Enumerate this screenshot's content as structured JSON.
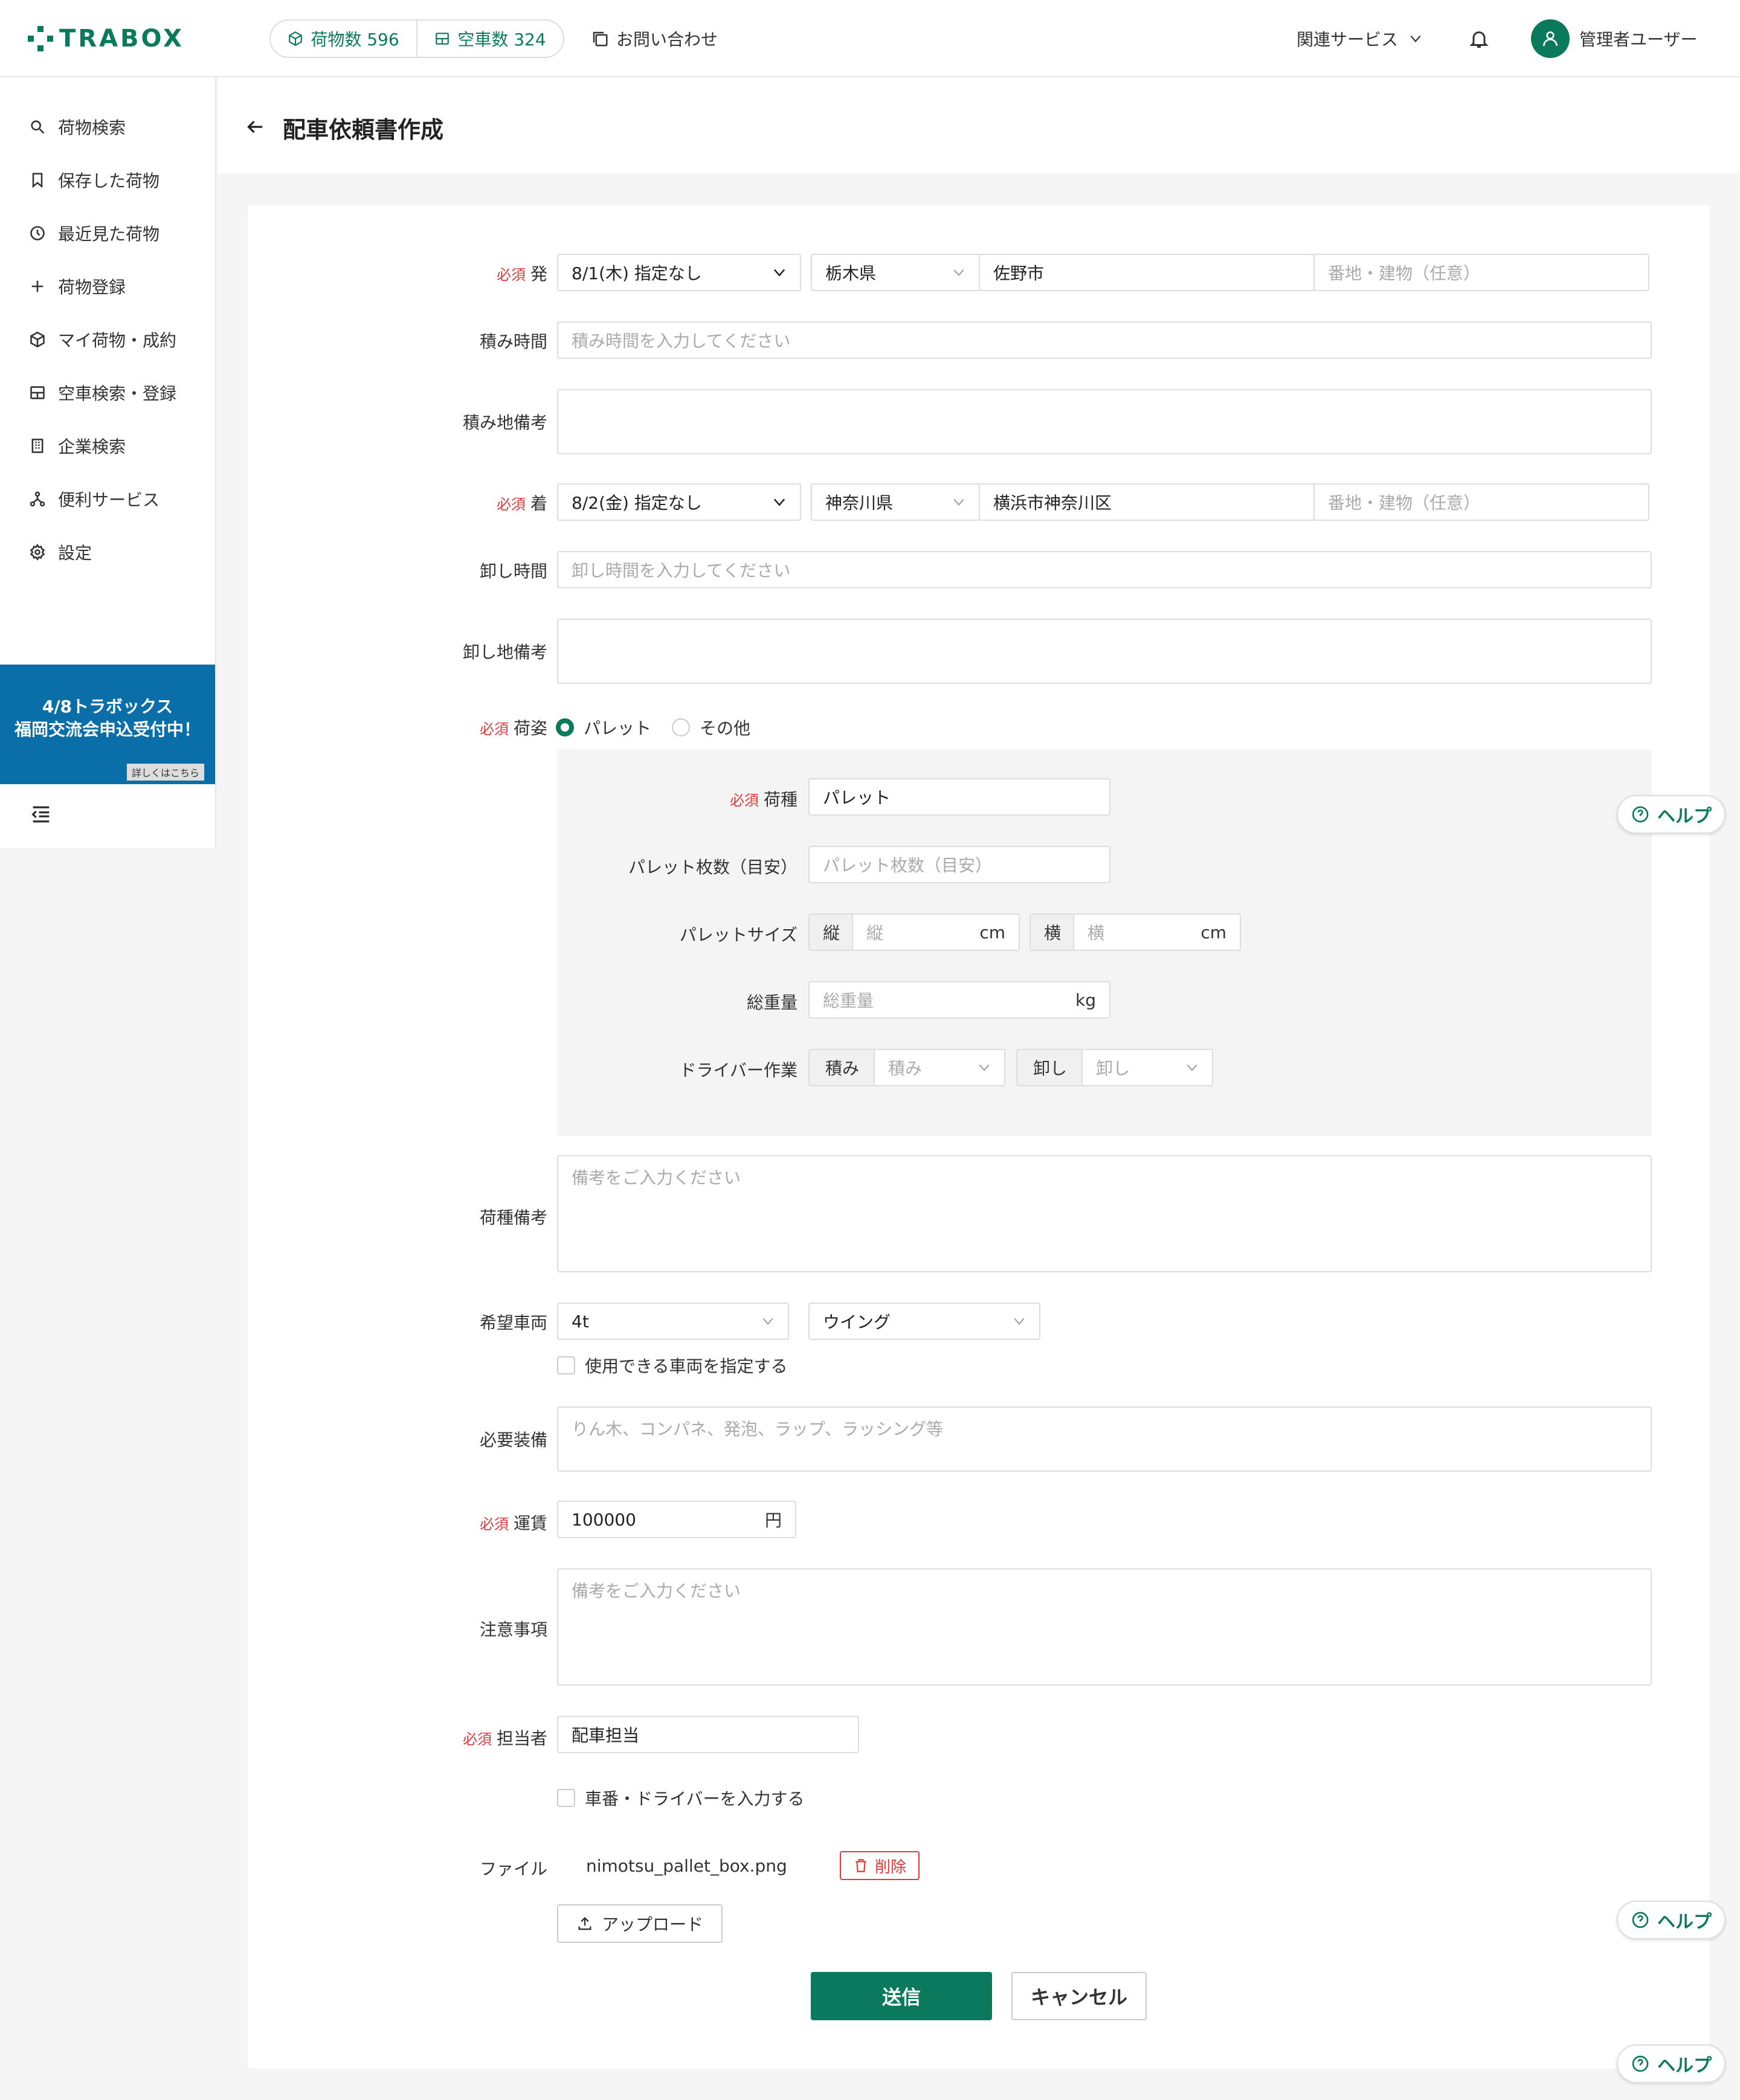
{
  "brand": {
    "name": "TRABOX",
    "color": "#0b7a5c"
  },
  "header": {
    "cargo_count": "荷物数 596",
    "vehicle_count": "空車数 324",
    "contact": "お問い合わせ",
    "related_services": "関連サービス",
    "user_name": "管理者ユーザー"
  },
  "sidebar": {
    "items": [
      {
        "label": "荷物検索",
        "icon": "search-icon"
      },
      {
        "label": "保存した荷物",
        "icon": "bookmark-icon"
      },
      {
        "label": "最近見た荷物",
        "icon": "history-icon"
      },
      {
        "label": "荷物登録",
        "icon": "plus-icon"
      },
      {
        "label": "マイ荷物・成約",
        "icon": "box-icon"
      },
      {
        "label": "空車検索・登録",
        "icon": "truck-icon"
      },
      {
        "label": "企業検索",
        "icon": "building-icon"
      },
      {
        "label": "便利サービス",
        "icon": "network-icon"
      },
      {
        "label": "設定",
        "icon": "gear-icon"
      }
    ],
    "banner": {
      "line1": "4/8トラボックス",
      "line2": "福岡交流会申込受付中！",
      "more": "詳しくはこちら"
    }
  },
  "page": {
    "title": "配車依頼書作成"
  },
  "form": {
    "required_label": "必須",
    "origin": {
      "label": "発",
      "date": "8/1(木) 指定なし",
      "prefecture": "栃木県",
      "city": "佐野市",
      "address_placeholder": "番地・建物（任意）"
    },
    "load_time": {
      "label": "積み時間",
      "placeholder": "積み時間を入力してください"
    },
    "load_note": {
      "label": "積み地備考",
      "value": ""
    },
    "destination": {
      "label": "着",
      "date": "8/2(金) 指定なし",
      "prefecture": "神奈川県",
      "city": "横浜市神奈川区",
      "address_placeholder": "番地・建物（任意）"
    },
    "unload_time": {
      "label": "卸し時間",
      "placeholder": "卸し時間を入力してください"
    },
    "unload_note": {
      "label": "卸し地備考",
      "value": ""
    },
    "packing": {
      "label": "荷姿",
      "options": [
        "パレット",
        "その他"
      ],
      "selected": "パレット"
    },
    "cargo_type": {
      "label": "荷種",
      "value": "パレット"
    },
    "pallet_count": {
      "label": "パレット枚数（目安）",
      "placeholder": "パレット枚数（目安）"
    },
    "pallet_size": {
      "label": "パレットサイズ",
      "length_addon": "縦",
      "length_placeholder": "縦",
      "length_unit": "cm",
      "width_addon": "横",
      "width_placeholder": "横",
      "width_unit": "cm"
    },
    "total_weight": {
      "label": "総重量",
      "placeholder": "総重量",
      "unit": "kg"
    },
    "driver_work": {
      "label": "ドライバー作業",
      "load_addon": "積み",
      "load_placeholder": "積み",
      "unload_addon": "卸し",
      "unload_placeholder": "卸し"
    },
    "cargo_note": {
      "label": "荷種備考",
      "placeholder": "備考をご入力ください"
    },
    "vehicle": {
      "label": "希望車両",
      "size": "4t",
      "body": "ウイング",
      "check_label": "使用できる車両を指定する"
    },
    "equipment": {
      "label": "必要装備",
      "placeholder": "りん木、コンパネ、発泡、ラップ、ラッシング等"
    },
    "fare": {
      "label": "運賃",
      "value": "100000",
      "unit": "円"
    },
    "notes": {
      "label": "注意事項",
      "placeholder": "備考をご入力ください"
    },
    "person": {
      "label": "担当者",
      "value": "配車担当"
    },
    "driver_check_label": "車番・ドライバーを入力する",
    "file": {
      "label": "ファイル",
      "name": "nimotsu_pallet_box.png",
      "delete_label": "削除",
      "upload_label": "アップロード"
    },
    "submit_label": "送信",
    "cancel_label": "キャンセル"
  },
  "help_label": "ヘルプ"
}
